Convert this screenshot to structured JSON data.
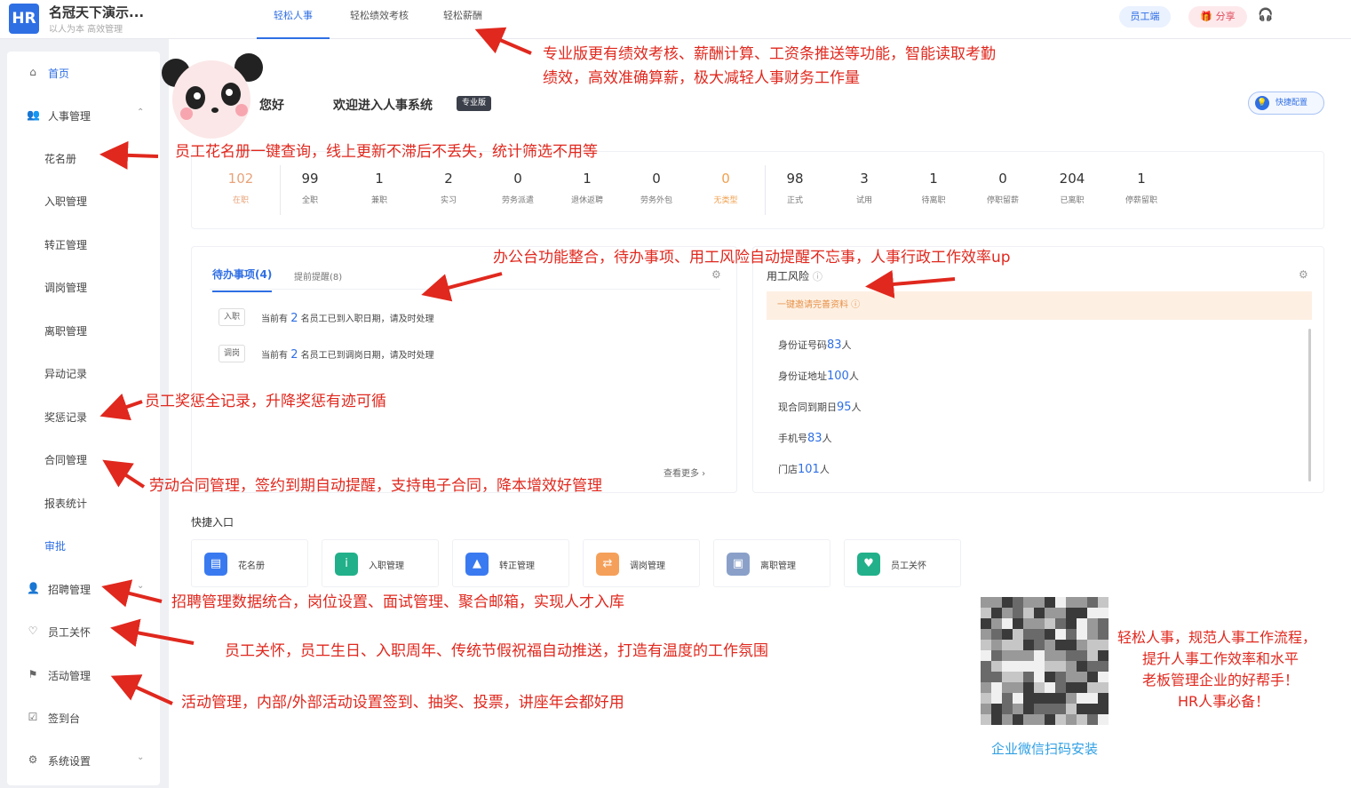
{
  "brand": {
    "logo": "HR",
    "name": "名冠天下演示...",
    "tagline": "以人为本 高效管理"
  },
  "tabs": [
    "轻松人事",
    "轻松绩效考核",
    "轻松薪酬"
  ],
  "header": {
    "employee_btn": "员工端",
    "share_btn": "分享"
  },
  "sidebar": {
    "items": [
      {
        "label": "首页",
        "icon": "home-icon"
      },
      {
        "label": "人事管理",
        "icon": "users-icon"
      },
      {
        "label": "花名册"
      },
      {
        "label": "入职管理"
      },
      {
        "label": "转正管理"
      },
      {
        "label": "调岗管理"
      },
      {
        "label": "离职管理"
      },
      {
        "label": "异动记录"
      },
      {
        "label": "奖惩记录"
      },
      {
        "label": "合同管理"
      },
      {
        "label": "报表统计"
      },
      {
        "label": "审批"
      },
      {
        "label": "招聘管理",
        "icon": "user-icon"
      },
      {
        "label": "员工关怀",
        "icon": "care-icon"
      },
      {
        "label": "活动管理",
        "icon": "flag-icon"
      },
      {
        "label": "签到台",
        "icon": "check-icon"
      },
      {
        "label": "系统设置",
        "icon": "gear-icon"
      }
    ]
  },
  "welcome": {
    "greeting": "您好",
    "message": "欢迎进入人事系统",
    "badge": "专业版",
    "quick_config": "快捷配置"
  },
  "stats": [
    {
      "num": "102",
      "label": "在职",
      "color": "#e8a37a"
    },
    {
      "num": "99",
      "label": "全职"
    },
    {
      "num": "1",
      "label": "兼职"
    },
    {
      "num": "2",
      "label": "实习"
    },
    {
      "num": "0",
      "label": "劳务派遣"
    },
    {
      "num": "1",
      "label": "退休返聘"
    },
    {
      "num": "0",
      "label": "劳务外包"
    },
    {
      "num": "0",
      "label": "无类型",
      "color": "#f0a050"
    },
    {
      "num": "98",
      "label": "正式"
    },
    {
      "num": "3",
      "label": "试用"
    },
    {
      "num": "1",
      "label": "待离职"
    },
    {
      "num": "0",
      "label": "停职留薪"
    },
    {
      "num": "204",
      "label": "已离职"
    },
    {
      "num": "1",
      "label": "停薪留职"
    }
  ],
  "todo": {
    "tab_active": "待办事项(4)",
    "tab_other": "提前提醒(8)",
    "items": [
      {
        "tag": "入职",
        "pre": "当前有",
        "count": "2",
        "post": "名员工已到入职日期，请及时处理"
      },
      {
        "tag": "调岗",
        "pre": "当前有",
        "count": "2",
        "post": "名员工已到调岗日期，请及时处理"
      }
    ],
    "more": "查看更多 ›"
  },
  "risk": {
    "title": "用工风险",
    "banner": "一键邀请完善资料 ⓘ",
    "rows": [
      {
        "label": "身份证号码",
        "count": "83",
        "unit": "人"
      },
      {
        "label": "身份证地址",
        "count": "100",
        "unit": "人"
      },
      {
        "label": "现合同到期日",
        "count": "95",
        "unit": "人"
      },
      {
        "label": "手机号",
        "count": "83",
        "unit": "人"
      },
      {
        "label": "门店",
        "count": "101",
        "unit": "人"
      }
    ]
  },
  "quick_entry": {
    "title": "快捷入口",
    "items": [
      {
        "label": "花名册",
        "color": "#3a7af0",
        "glyph": "▤"
      },
      {
        "label": "入职管理",
        "color": "#22b08a",
        "glyph": "i"
      },
      {
        "label": "转正管理",
        "color": "#3a7af0",
        "glyph": "▲"
      },
      {
        "label": "调岗管理",
        "color": "#f5a05a",
        "glyph": "⇄"
      },
      {
        "label": "离职管理",
        "color": "#8aa0c8",
        "glyph": "▣"
      },
      {
        "label": "员工关怀",
        "color": "#22b08a",
        "glyph": "♥"
      }
    ]
  },
  "qr": {
    "caption": "企业微信扫码安装"
  },
  "annotations": {
    "a1_l1": "专业版更有绩效考核、薪酬计算、工资条推送等功能，智能读取考勤",
    "a1_l2": "绩效，高效准确算薪，极大减轻人事财务工作量",
    "a2": "员工花名册一键查询，线上更新不滞后不丢失，统计筛选不用等",
    "a3": "办公台功能整合，待办事项、用工风险自动提醒不忘事，人事行政工作效率up",
    "a4": "员工奖惩全记录，升降奖惩有迹可循",
    "a5": "劳动合同管理，签约到期自动提醒，支持电子合同，降本增效好管理",
    "a6": "招聘管理数据统合，岗位设置、面试管理、聚合邮箱，实现人才入库",
    "a7": "员工关怀，员工生日、入职周年、传统节假祝福自动推送，打造有温度的工作氛围",
    "a8": "活动管理，内部/外部活动设置签到、抽奖、投票，讲座年会都好用",
    "a9_l1": "轻松人事，规范人事工作流程，",
    "a9_l2": "提升人事工作效率和水平",
    "a9_l3": "老板管理企业的好帮手！",
    "a9_l4": "HR人事必备！"
  }
}
